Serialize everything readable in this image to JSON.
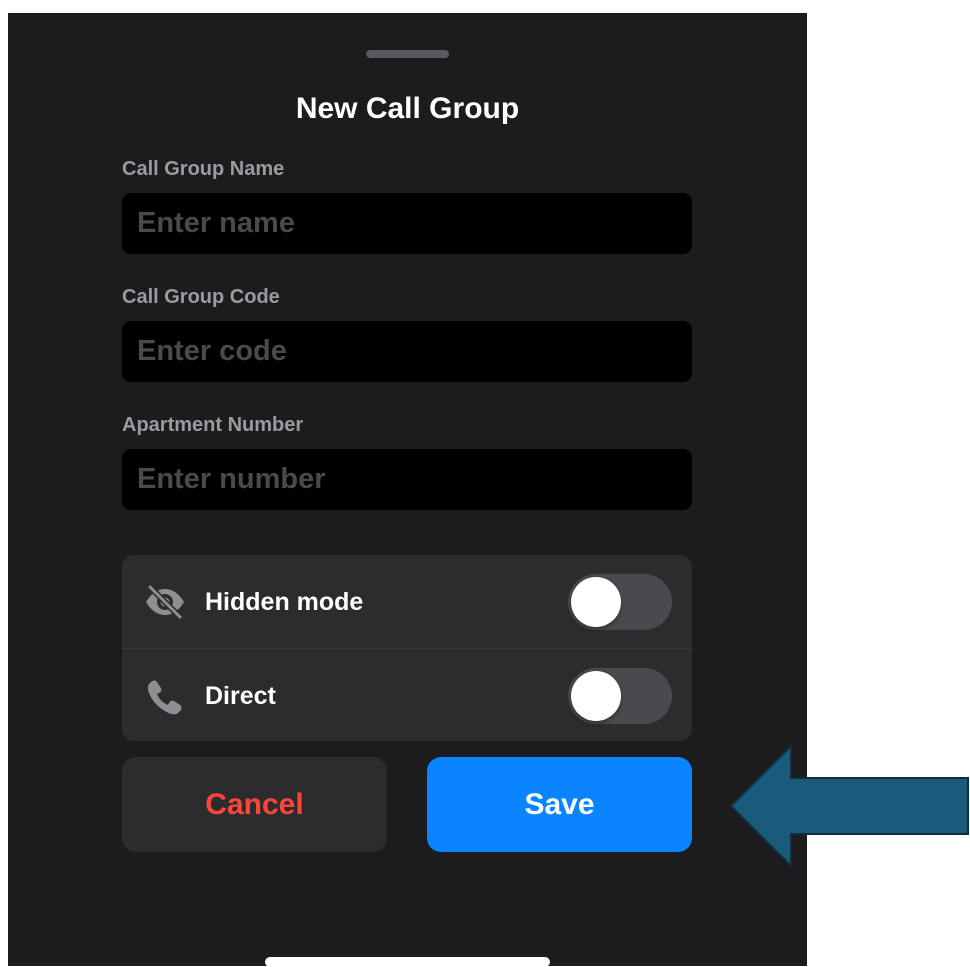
{
  "sheet": {
    "title": "New Call Group"
  },
  "form": {
    "fields": [
      {
        "label": "Call Group Name",
        "placeholder": "Enter name",
        "value": ""
      },
      {
        "label": "Call Group Code",
        "placeholder": "Enter code",
        "value": ""
      },
      {
        "label": "Apartment Number",
        "placeholder": "Enter number",
        "value": ""
      }
    ]
  },
  "toggles": [
    {
      "label": "Hidden mode",
      "icon": "eye-slash-icon",
      "on": false
    },
    {
      "label": "Direct",
      "icon": "phone-icon",
      "on": false
    }
  ],
  "actions": {
    "cancel_label": "Cancel",
    "save_label": "Save"
  },
  "colors": {
    "sheet_background": "#1c1c1e",
    "input_background": "#000000",
    "card_background": "#2c2c2e",
    "cancel_text": "#ff453a",
    "save_background": "#0a84ff",
    "annotation_arrow": "#1a5b7c"
  }
}
